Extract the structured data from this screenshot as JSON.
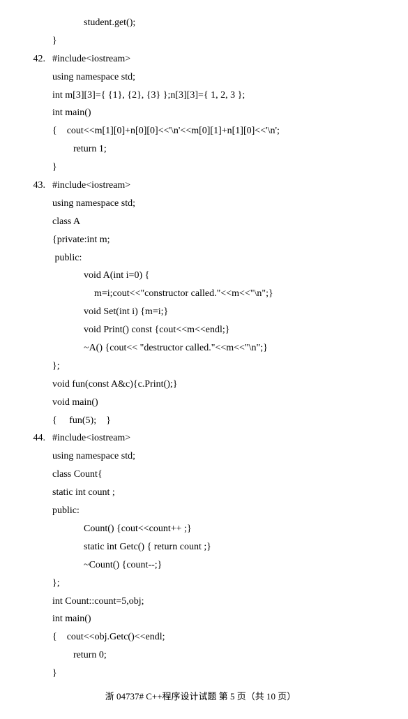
{
  "pre": {
    "l1": "student.get();",
    "l2": "}"
  },
  "q42": {
    "num": "42.",
    "l1": "#include<iostream>",
    "l2": "using namespace std;",
    "l3": "int m[3][3]={ {1}, {2}, {3} };n[3][3]={ 1, 2, 3 };",
    "l4": "int main()",
    "l5": "{    cout<<m[1][0]+n[0][0]<<'\\n'<<m[0][1]+n[1][0]<<'\\n';",
    "l6": "return 1;",
    "l7": "}"
  },
  "q43": {
    "num": "43.",
    "l1": "#include<iostream>",
    "l2": "using namespace std;",
    "l3": "class A",
    "l4": "{private:int m;",
    "l5": " public:",
    "l6": "void A(int i=0) {",
    "l7": "m=i;cout<<\"constructor called.\"<<m<<\"\\n\";}",
    "l8": "void Set(int i) {m=i;}",
    "l9": "void Print() const {cout<<m<<endl;}",
    "l10": "~A() {cout<< \"destructor called.\"<<m<<\"\\n\";}",
    "l11": "};",
    "l12": "void fun(const A&c){c.Print();}",
    "l13": "void main()",
    "l14": "{     fun(5);    }"
  },
  "q44": {
    "num": "44.",
    "l1": "#include<iostream>",
    "l2": "using namespace std;",
    "l3": "class Count{",
    "l4": "static int count ;",
    "l5": "public:",
    "l6": "Count() {cout<<count++ ;}",
    "l7": "static int Getc() { return count ;}",
    "l8": "~Count() {count--;}",
    "l9": "};",
    "l10": "int Count::count=5,obj;",
    "l11": "int main()",
    "l12": "{    cout<<obj.Getc()<<endl;",
    "l13": "return 0;",
    "l14": "}"
  },
  "footer": "浙 04737# C++程序设计试题 第 5 页（共 10 页）"
}
